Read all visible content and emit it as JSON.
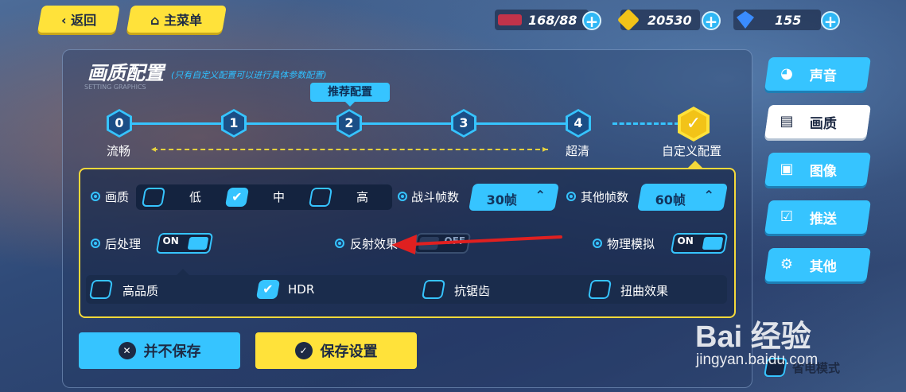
{
  "topbar": {
    "back_label": "返回",
    "main_menu_label": "主菜单",
    "stamina": "168/88",
    "coins": "20530",
    "crystals": "155",
    "plus": "+"
  },
  "panel": {
    "title": "画质配置",
    "subtitle": "(只有自定义配置可以进行具体参数配置)",
    "caption": "SETTING GRAPHICS",
    "recommended_label": "推荐配置",
    "levels": [
      "0",
      "1",
      "2",
      "3",
      "4"
    ],
    "left_label": "流畅",
    "right_label": "超清",
    "custom_label": "自定义配置"
  },
  "settings": {
    "quality_label": "画质",
    "quality_options": [
      "低",
      "中",
      "高"
    ],
    "quality_selected": "中",
    "battle_fps_label": "战斗帧数",
    "battle_fps_value": "30帧",
    "other_fps_label": "其他帧数",
    "other_fps_value": "60帧",
    "post_label": "后处理",
    "post_value": "ON",
    "reflection_label": "反射效果",
    "reflection_value": "OFF",
    "physics_label": "物理模拟",
    "physics_value": "ON",
    "options": [
      {
        "label": "高品质",
        "checked": false
      },
      {
        "label": "HDR",
        "checked": true
      },
      {
        "label": "抗锯齿",
        "checked": false
      },
      {
        "label": "扭曲效果",
        "checked": false
      }
    ]
  },
  "buttons": {
    "discard": "并不保存",
    "save": "保存设置"
  },
  "side_menu": [
    {
      "label": "声音",
      "icon": "sound-icon",
      "active": false
    },
    {
      "label": "画质",
      "icon": "quality-icon",
      "active": true
    },
    {
      "label": "图像",
      "icon": "image-icon",
      "active": false
    },
    {
      "label": "推送",
      "icon": "push-icon",
      "active": false
    },
    {
      "label": "其他",
      "icon": "gear-icon",
      "active": false
    }
  ],
  "power_saving_label": "省电模式",
  "watermark": {
    "brand": "Bai 经验",
    "url": "jingyan.baidu.com"
  },
  "colors": {
    "accent": "#36c4ff",
    "yellow": "#ffe23a",
    "dark": "#1d2a44",
    "arrow": "#e02020"
  }
}
